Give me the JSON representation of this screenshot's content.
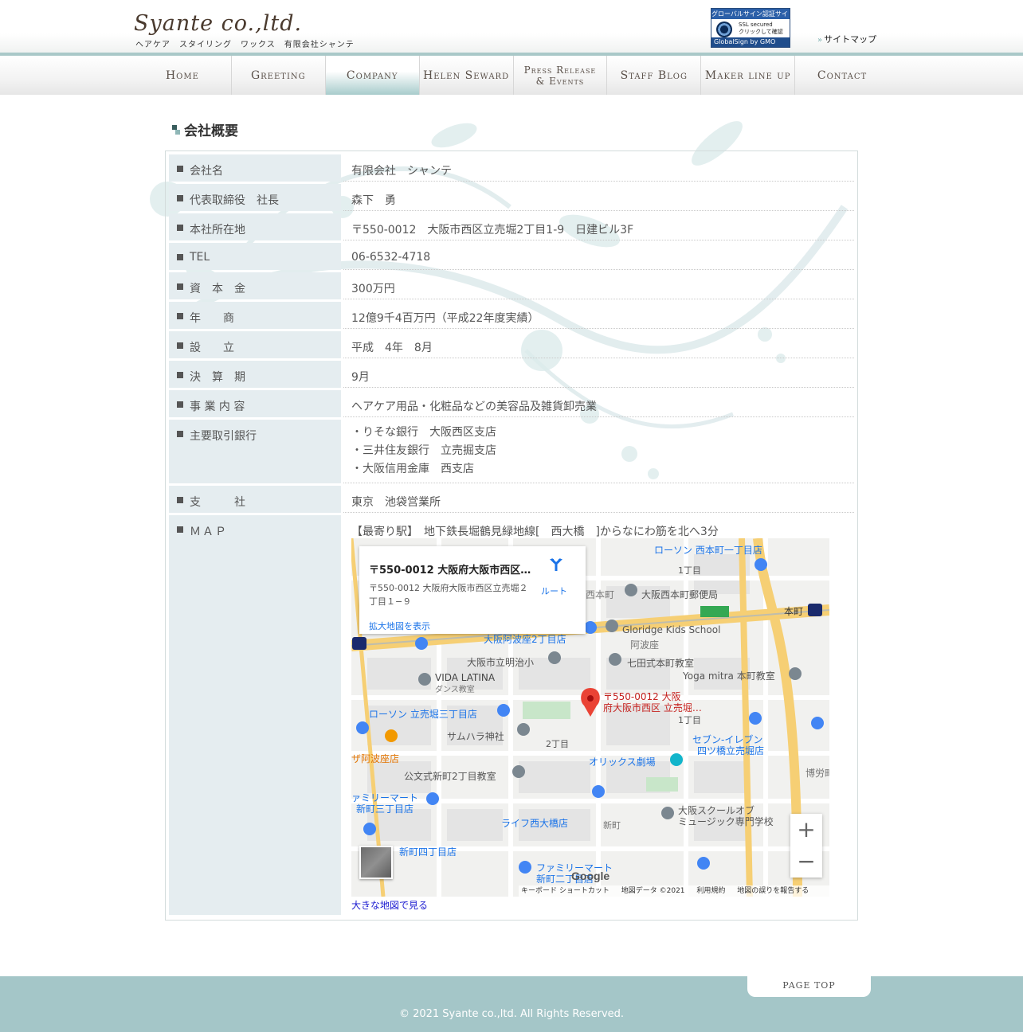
{
  "header": {
    "logo": "Syante co.,ltd.",
    "tagline": "ヘアケア　スタイリング　ワックス　有限会社シャンテ",
    "ssl_badge": {
      "top": "グローバルサイン認証サイト",
      "line1": "SSL secured",
      "line2": "クリックして確認",
      "bottom": "GlobalSign by GMO"
    },
    "sitemap": "サイトマップ"
  },
  "nav": [
    {
      "label": "Home"
    },
    {
      "label": "Greeting"
    },
    {
      "label": "Company"
    },
    {
      "label": "Helen Seward"
    },
    {
      "label1": "Press Release",
      "label2": "& Events"
    },
    {
      "label": "Staff Blog"
    },
    {
      "label": "Maker line up"
    },
    {
      "label": "Contact"
    }
  ],
  "section_title": "会社概要",
  "rows": [
    {
      "label": "会社名",
      "value": "有限会社　シャンテ"
    },
    {
      "label": "代表取締役　社長",
      "value": "森下　勇"
    },
    {
      "label": "本社所在地",
      "value": "〒550-0012　大阪市西区立売堀2丁目1-9　日建ビル3F"
    },
    {
      "label": "TEL",
      "value": "06-6532-4718"
    },
    {
      "label": "資　本　金",
      "value": "300万円"
    },
    {
      "label": "年　　商",
      "value": "12億9千4百万円（平成22年度実績）"
    },
    {
      "label": "設　　立",
      "value": "平成　4年　8月"
    },
    {
      "label": "決　算　期",
      "value": "9月"
    },
    {
      "label": "事 業 内 容",
      "value": "ヘアケア用品・化粧品などの美容品及雑貨卸売業"
    },
    {
      "label": "主要取引銀行",
      "banks": [
        "・りそな銀行　大阪西区支店",
        "・三井住友銀行　立売掘支店",
        "・大阪信用金庫　西支店"
      ]
    },
    {
      "label": "支　　　社",
      "value": "東京　池袋営業所"
    },
    {
      "label": "ＭＡＰ",
      "value": "【最寄り駅】　地下鉄長堀鶴見緑地線[　西大橋　]からなにわ筋を北へ3分"
    }
  ],
  "map": {
    "card_title": "〒550-0012 大阪府大阪市西区…",
    "card_address": "〒550-0012 大阪府大阪市西区立売堀２丁目１−９",
    "card_link": "拡大地図を表示",
    "route_label": "ルート",
    "pin_label1": "〒550-0012 大阪",
    "pin_label2": "府大阪市西区 立売堀…",
    "labels": {
      "l1": "ローソン 西本町一丁目店",
      "l2": "大阪西本町郵便局",
      "l3": "Gloridge Kids School",
      "l4": "七田式本町教室",
      "l5": "Yoga mitra 本町教室",
      "l6": "大阪市立明治小",
      "l7": "VIDA LATINA",
      "l7b": "ダンス教室",
      "l8": "ローソン 立売堀三丁目店",
      "l9": "サムハラ神社",
      "l10": "ザ阿波座店",
      "l11": "公文式新町2丁目教室",
      "l12": "オリックス劇場",
      "l13": "セブン-イレブン",
      "l13b": "四ツ橋立売堀店",
      "l14": "ァミリーマート",
      "l14b": "新町三丁目店",
      "l15": "ライフ西大橋店",
      "l16": "大阪スクールオブ",
      "l16b": "ミュージック専門学校",
      "l17": "新町四丁目店",
      "l18": "ファミリーマート",
      "l18b": "新町二丁目店",
      "l19": "大阪阿波座2丁目店",
      "l20": "本町",
      "l21": "阿波座",
      "l22": "西本町",
      "l23": "2丁目",
      "l24": "1丁目",
      "l25": "新町",
      "l26": "博労町"
    },
    "footer": [
      "キーボード ショートカット",
      "地図データ ©2021",
      "利用規約",
      "地図の誤りを報告する"
    ],
    "google": "Google",
    "zoom_in": "+",
    "zoom_out": "−",
    "big_map_link": "大きな地図で見る"
  },
  "page_top": "PAGE TOP",
  "copyright": "©  2021  Syante co.,ltd. All Rights Reserved."
}
